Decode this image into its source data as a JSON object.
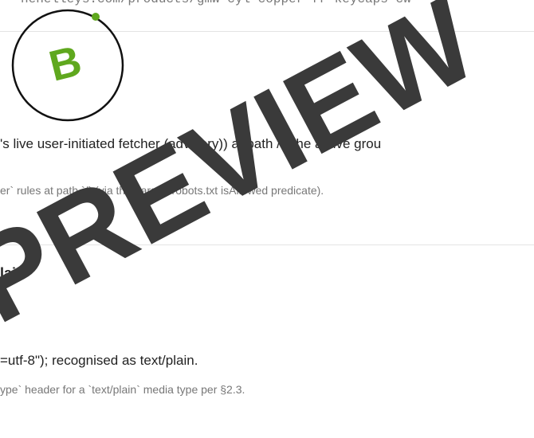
{
  "header": {
    "url": "henelleys.com/products/gmw-cyl-copper-fr-keycaps-cw"
  },
  "logo": {
    "letter": "B",
    "ring_color": "#111111",
    "dot_color": "#5fa81e",
    "letter_color": "#5fa81e"
  },
  "robots_section": {
    "summary": "'s live user-initiated fetcher (advisory)) at path /. The active grou",
    "detail": "er` rules at path `/` (via the parsed robots.txt isAllowed predicate)."
  },
  "content_type_section": {
    "heading": "lain",
    "summary": "=utf-8\"); recognised as text/plain.",
    "detail": "ype` header for a `text/plain` media type per §2.3."
  },
  "watermark": {
    "text": "E PREVIEW",
    "color": "#3a3a3a"
  }
}
